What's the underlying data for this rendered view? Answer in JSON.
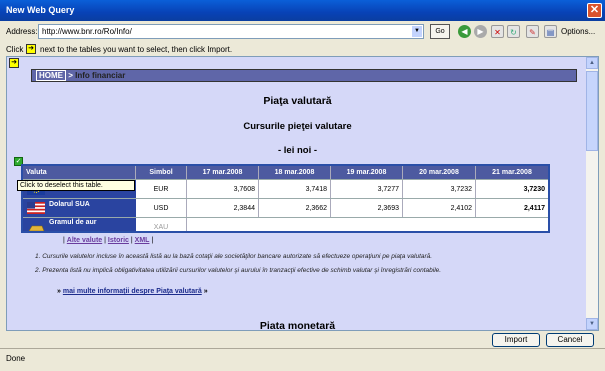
{
  "window": {
    "title": "New Web Query",
    "close_glyph": "✕"
  },
  "address": {
    "label": "Address:",
    "value": "http://www.bnr.ro/Ro/Info/",
    "go_label": "Go",
    "options_label": "Options..."
  },
  "hint": {
    "prefix": "Click",
    "arrow": "➜",
    "suffix": "next to the tables you want to select, then click Import."
  },
  "breadcrumb": {
    "home": "HOME",
    "separator": ">",
    "current": "Info financiar"
  },
  "page": {
    "title": "Piaţa valutară",
    "subtitle": "Cursurile pieţei valutare",
    "unit": "- lei noi -",
    "tooltip": "Click to deselect this table.",
    "table_headers": [
      "Valuta",
      "Simbol",
      "17 mar.2008",
      "18 mar.2008",
      "19 mar.2008",
      "20 mar.2008",
      "21 mar.2008"
    ],
    "rows": [
      {
        "name": "",
        "symbol": "EUR",
        "values": [
          "3,7608",
          "3,7418",
          "3,7277",
          "3,7232",
          "3,7230"
        ]
      },
      {
        "name": "Dolarul SUA",
        "symbol": "USD",
        "values": [
          "2,3844",
          "2,3662",
          "2,3693",
          "2,4102",
          "2,4117"
        ]
      },
      {
        "name": "Gramul de aur",
        "symbol": "XAU",
        "values": [
          "",
          "",
          "",
          "",
          ""
        ]
      }
    ],
    "links": {
      "alte_valute": "Alte valute",
      "istoric": "Istoric",
      "xml": "XML",
      "sep": "|"
    },
    "notes": [
      "1. Cursurile valutelor incluse în această listă au la bază cotaţii ale societăţilor bancare autorizate să efectueze operaţiuni pe piaţa valutară.",
      "2. Prezenta listă nu implică obligativitatea utilizării cursurilor valutelor şi aurului în tranzacţii efective de schimb valutar şi înregistrări contabile."
    ],
    "more_prefix": "»",
    "more_link": "mai multe informaţii despre Piaţa valutară",
    "more_suffix": "»",
    "section2": "Piata monetară"
  },
  "buttons": {
    "import": "Import",
    "cancel": "Cancel"
  },
  "status": "Done",
  "colors": {
    "title_bar": "#0842b6",
    "page_bg": "#d5d8f8",
    "table_header": "#4d5aa0",
    "selection": "#2a4fa8"
  }
}
